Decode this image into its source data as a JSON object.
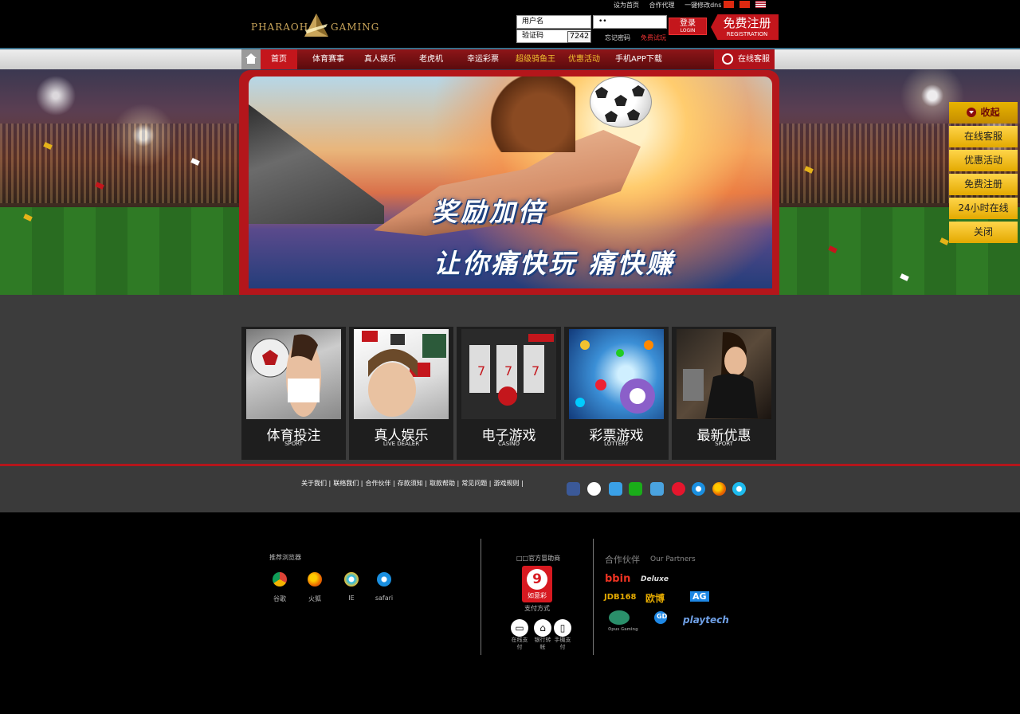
{
  "header": {
    "logo_left": "PHARAOH",
    "logo_right": "GAMING",
    "top_links": [
      "设为首页",
      "合作代理",
      "一键修改dns"
    ],
    "username_placeholder": "用户名",
    "password_value": "••",
    "captcha_label": "验证码",
    "captcha_code": "7242",
    "forgot_password": "忘记密码",
    "free_trial": "免费试玩",
    "login_main": "登录",
    "login_sub": "LOGIN",
    "register_main": "免费注册",
    "register_sub": "REGISTRATION"
  },
  "nav": {
    "items": [
      "首页",
      "体育赛事",
      "真人娱乐",
      "老虎机",
      "幸运彩票",
      "超级骑鱼王",
      "优惠活动",
      "手机APP下载"
    ],
    "customer_service": "在线客服"
  },
  "banner": {
    "line1": "奖励加倍",
    "line2": "让你痛快玩 痛快赚"
  },
  "side_panel": {
    "items": [
      "收起",
      "在线客服",
      "优惠活动",
      "免费注册",
      "24小时在线",
      "关闭"
    ]
  },
  "games": [
    {
      "title": "体育投注",
      "sub": "SPORT"
    },
    {
      "title": "真人娱乐",
      "sub": "LIVE DEALER"
    },
    {
      "title": "电子游戏",
      "sub": "CASINO"
    },
    {
      "title": "彩票游戏",
      "sub": "LOTTERY"
    },
    {
      "title": "最新优惠",
      "sub": "SPORT"
    }
  ],
  "footer_links": [
    "关于我们 |",
    "联络我们 |",
    "合作伙伴 |",
    "存款须知 |",
    "取款帮助 |",
    "常见问题 |",
    "游戏规则 |"
  ],
  "social_icons": [
    "facebook-icon",
    "renren-icon",
    "qzone-icon",
    "wechat-icon",
    "qq-icon",
    "weibo-icon",
    "safari-icon",
    "firefox-icon",
    "ie-icon"
  ],
  "browsers": {
    "heading": "推荐浏览器",
    "items": [
      "谷歌",
      "火狐",
      "IE",
      "safari"
    ]
  },
  "payment": {
    "heading": "□□官方冒助商",
    "logo_text": "如意彩",
    "caption": "支付方式",
    "methods": [
      "在线支付",
      "银行转帐",
      "手機支付"
    ]
  },
  "partners": {
    "heading_cn": "合作伙伴",
    "heading_en": "Our Partners",
    "logos": [
      "bbin",
      "Deluxe",
      "JDB168",
      "欧博",
      "AG",
      "Opus Gaming",
      "GD",
      "playtech"
    ]
  },
  "colors": {
    "brand_red": "#c4161c",
    "gold": "#e3a900",
    "gold_text": "#f2c230",
    "dark_bg": "#000000",
    "panel_bg": "#3c3c3c"
  }
}
